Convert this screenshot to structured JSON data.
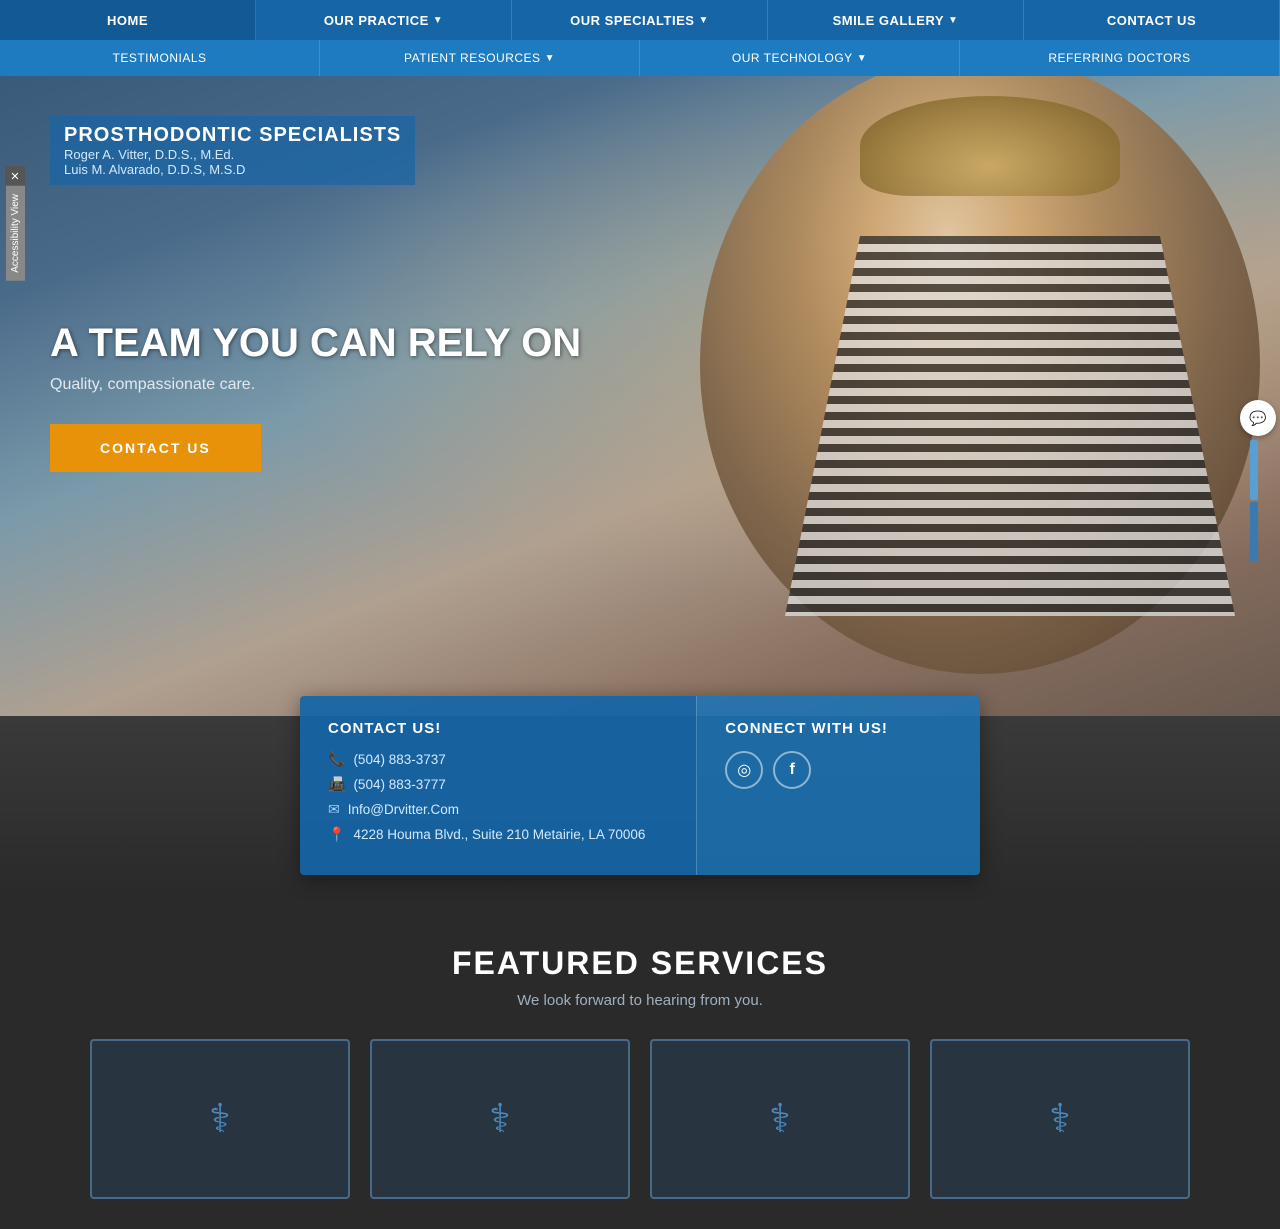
{
  "nav": {
    "top_items": [
      {
        "label": "HOME",
        "active": true
      },
      {
        "label": "OUR PRACTICE",
        "dropdown": true
      },
      {
        "label": "OUR SPECIALTIES",
        "dropdown": true
      },
      {
        "label": "SMILE GALLERY",
        "dropdown": true
      },
      {
        "label": "CONTACT US",
        "active": false
      }
    ],
    "bottom_items": [
      {
        "label": "TESTIMONIALS",
        "dropdown": false
      },
      {
        "label": "PATIENT RESOURCES",
        "dropdown": true
      },
      {
        "label": "OUR TECHNOLOGY",
        "dropdown": true
      },
      {
        "label": "REFERRING DOCTORS",
        "dropdown": false
      }
    ]
  },
  "hero": {
    "badge_title": "PROSTHODONTIC SPECIALISTS",
    "doctor1": "Roger A. Vitter, D.D.S., M.Ed.",
    "doctor2": "Luis M. Alvarado, D.D.S, M.S.D",
    "headline": "A TEAM YOU CAN RELY ON",
    "subtext": "Quality, compassionate care.",
    "cta_label": "CONTACT US"
  },
  "contact_section": {
    "heading": "CONTACT US!",
    "phone1": "(504) 883-3737",
    "fax": "(504) 883-3777",
    "email": "Info@Drvitter.Com",
    "address": "4228 Houma Blvd., Suite 210 Metairie, LA 70006",
    "connect_heading": "CONNECT WITH US!"
  },
  "featured": {
    "heading": "FEATURED SERVICES",
    "subtext": "We look forward to hearing from you."
  },
  "accessibility": {
    "label": "Accessibility View"
  },
  "icons": {
    "phone": "📞",
    "fax": "📠",
    "email": "✉",
    "location": "📍",
    "instagram": "◎",
    "facebook": "f",
    "dropdown_arrow": "▼",
    "close": "✕",
    "chat": "💬"
  }
}
